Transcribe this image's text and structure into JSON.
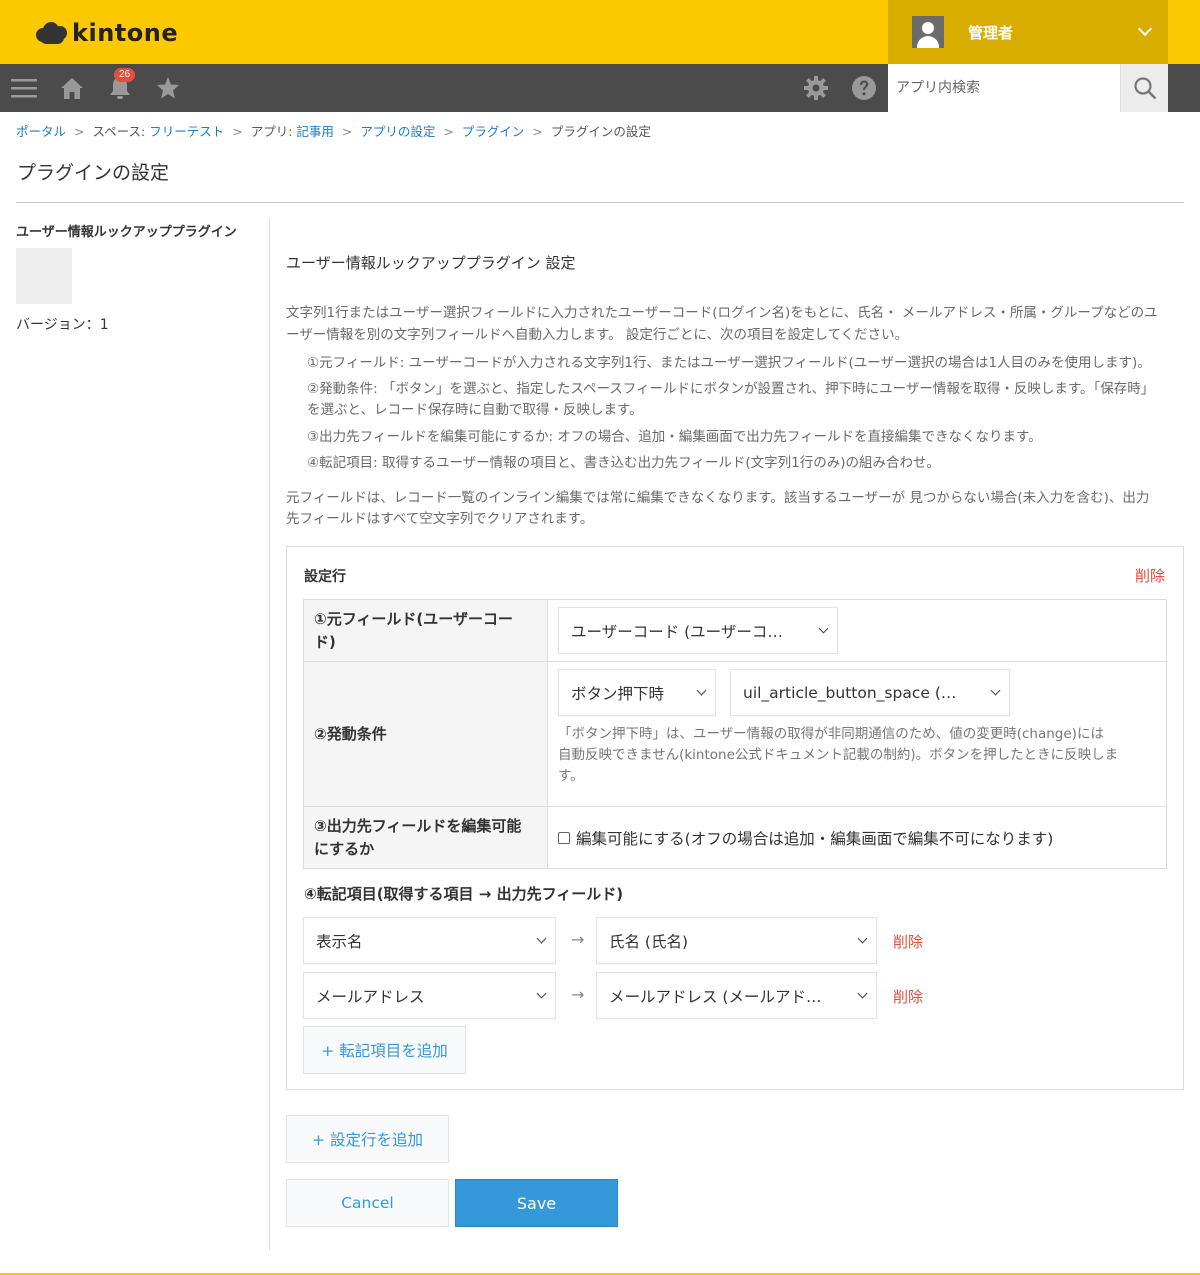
{
  "header": {
    "logo_text": "kintone",
    "user_name": "管理者",
    "notification_count": "26",
    "search_placeholder": "アプリ内検索"
  },
  "breadcrumb": {
    "portal": "ポータル",
    "space_prefix": "スペース: ",
    "space_name": "フリーテスト",
    "app_prefix": "アプリ: ",
    "app_name": "記事用",
    "app_settings": "アプリの設定",
    "plugins": "プラグイン",
    "current": "プラグインの設定",
    "separator": ">"
  },
  "page": {
    "title": "プラグインの設定"
  },
  "plugin": {
    "name": "ユーザー情報ルックアッププラグイン",
    "version": "バージョン：1"
  },
  "settings": {
    "heading": "ユーザー情報ルックアッププラグイン 設定",
    "desc1_line1": "文字列1行またはユーザー選択フィールドに入力されたユーザーコード(ログイン名)をもとに、氏名・ メールアドレス・所属・グループなどのユ",
    "desc1_line2": "ーザー情報を別の文字列フィールドへ自動入力します。 設定行ごとに、次の項目を設定してください。",
    "item1": "①元フィールド: ユーザーコードが入力される文字列1行、またはユーザー選択フィールド(ユーザー選択の場合は1人目のみを使用します)。",
    "item2_line1": "②発動条件: 「ボタン」を選ぶと、指定したスペースフィールドにボタンが設置され、押下時にユーザー情報を取得・反映します。「保存時」",
    "item2_line2": "を選ぶと、レコード保存時に自動で取得・反映します。",
    "item3": "③出力先フィールドを編集可能にするか: オフの場合、追加・編集画面で出力先フィールドを直接編集できなくなります。",
    "item4": "④転記項目: 取得するユーザー情報の項目と、書き込む出力先フィールド(文字列1行のみ)の組み合わせ。",
    "desc2_line1": "元フィールドは、レコード一覧のインライン編集では常に編集できなくなります。該当するユーザーが 見つからない場合(未入力を含む)、出力",
    "desc2_line2": "先フィールドはすべて空文字列でクリアされます。"
  },
  "row": {
    "title": "設定行",
    "delete_label": "削除",
    "source_label": "①元フィールド(ユーザーコード)",
    "source_label_l1": "①元フィールド(ユーザーコー",
    "source_label_l2": "ド)",
    "source_value": "ユーザーコード (ユーザーコ…",
    "trigger_label": "②発動条件",
    "trigger_value": "ボタン押下時",
    "space_value": "uil_article_button_space (…",
    "trigger_note_l1": "「ボタン押下時」は、ユーザー情報の取得が非同期通信のため、値の変更時(change)には",
    "trigger_note_l2": "自動反映できません(kintone公式ドキュメント記載の制約)。ボタンを押したときに反映しま",
    "trigger_note_l3": "す。",
    "editable_label_l1": "③出力先フィールドを編集可能",
    "editable_label_l2": "にするか",
    "editable_checkbox_label": "編集可能にする(オフの場合は追加・編集画面で編集不可になります)",
    "transfer_title": "④転記項目(取得する項目 → 出力先フィールド)",
    "mappings": [
      {
        "from": "表示名",
        "to": "氏名 (氏名)",
        "delete": "削除"
      },
      {
        "from": "メールアドレス",
        "to": "メールアドレス (メールアド…",
        "delete": "削除"
      }
    ],
    "arrow": "→",
    "add_mapping_label": "+ 転記項目を追加"
  },
  "actions": {
    "add_row_label": "+ 設定行を追加",
    "cancel_label": "Cancel",
    "save_label": "Save"
  },
  "colors": {
    "header_yellow": "#fcc800",
    "nav_gray": "#4b4b4b",
    "link_blue": "#1a7dc5",
    "delete_red": "#e74c3c",
    "save_blue": "#3498db"
  }
}
